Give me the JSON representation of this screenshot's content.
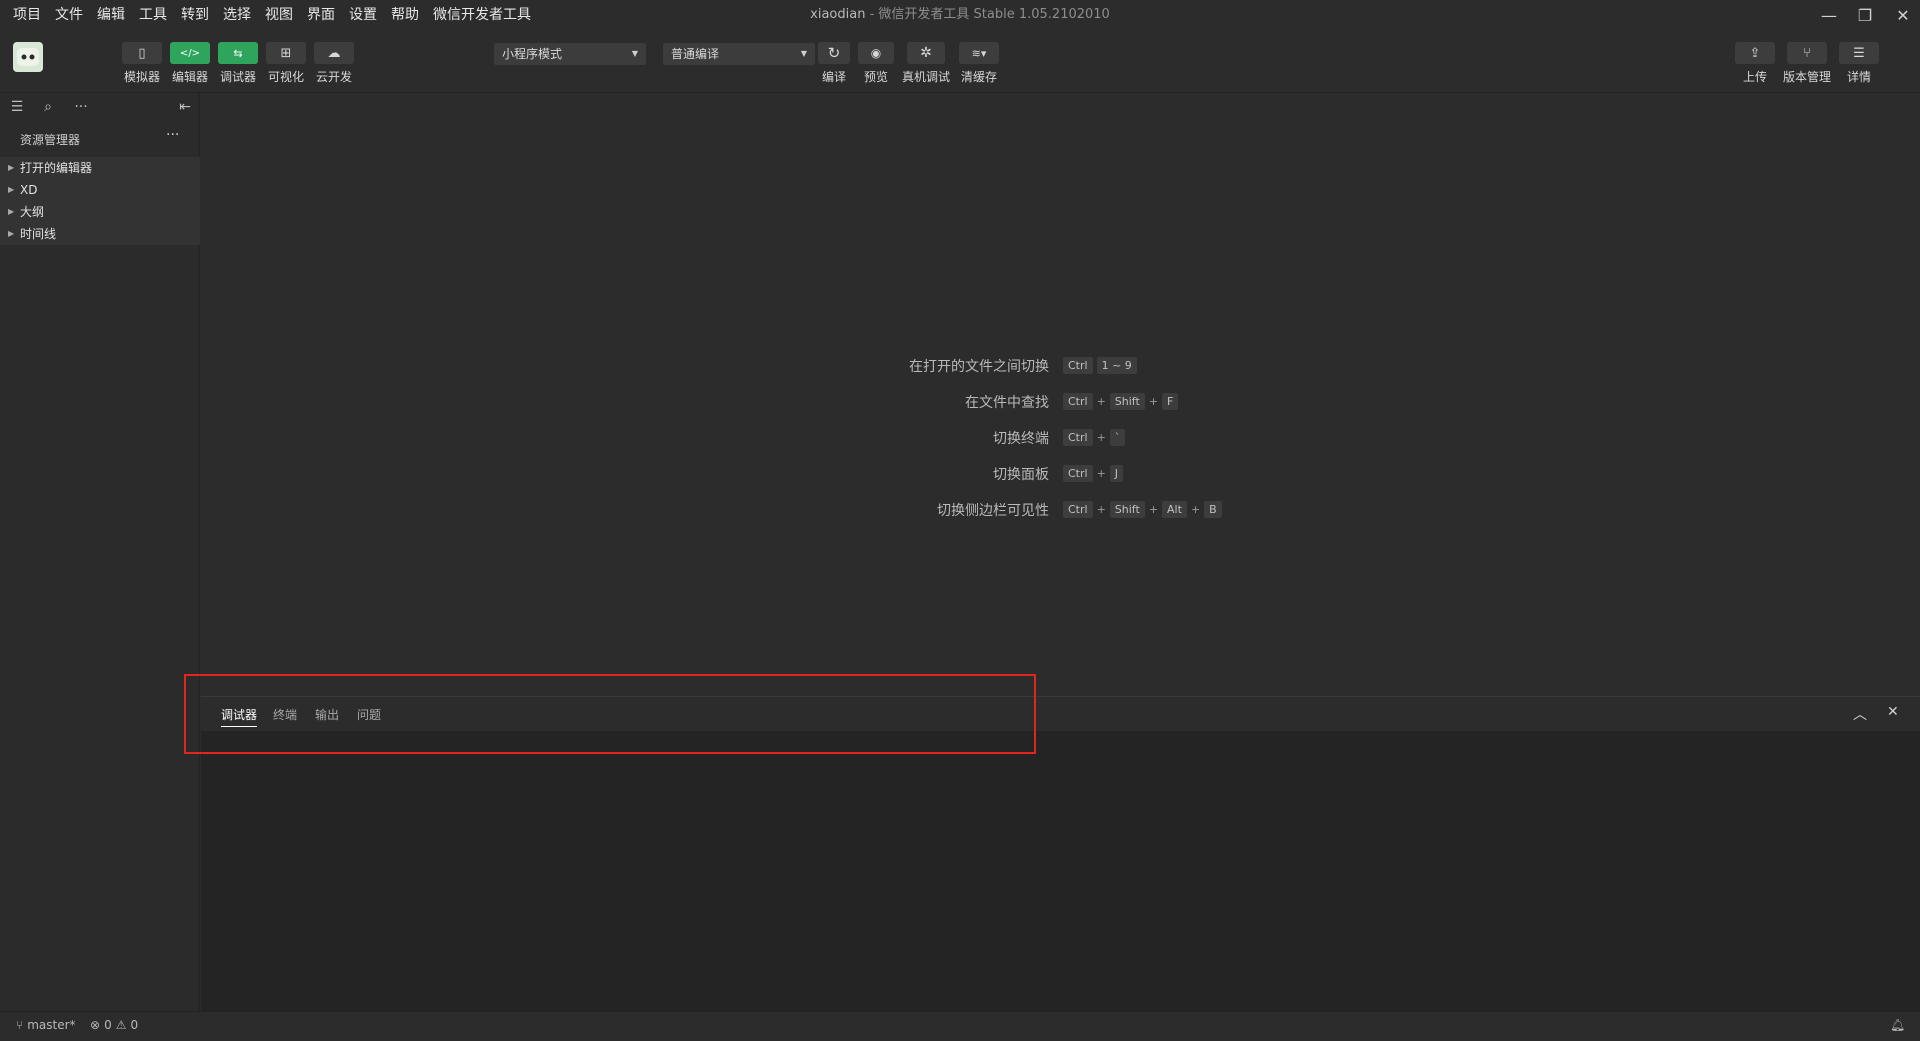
{
  "window": {
    "title_project": "xiaodian",
    "title_app": " - 微信开发者工具 Stable 1.05.2102010"
  },
  "menu": [
    "项目",
    "文件",
    "编辑",
    "工具",
    "转到",
    "选择",
    "视图",
    "界面",
    "设置",
    "帮助",
    "微信开发者工具"
  ],
  "toolbar": {
    "left_buttons": [
      {
        "label": "模拟器",
        "icon": "phone-icon",
        "glyph": "▯"
      },
      {
        "label": "编辑器",
        "icon": "code-icon",
        "glyph": "</>"
      },
      {
        "label": "调试器",
        "icon": "debug-icon",
        "glyph": "⇆"
      },
      {
        "label": "可视化",
        "icon": "layout-icon",
        "glyph": "⊞"
      },
      {
        "label": "云开发",
        "icon": "cloud-icon",
        "glyph": "☁"
      }
    ],
    "mode_select": "小程序模式",
    "compile_select": "普通编译",
    "mid_buttons": [
      {
        "label": "编译",
        "icon": "refresh-icon",
        "glyph": "↻"
      },
      {
        "label": "预览",
        "icon": "eye-icon",
        "glyph": "◉"
      },
      {
        "label": "真机调试",
        "icon": "bug-icon",
        "glyph": "✲"
      },
      {
        "label": "清缓存",
        "icon": "layers-icon",
        "glyph": "≋▾"
      }
    ],
    "right_buttons": [
      {
        "label": "上传",
        "icon": "upload-icon",
        "glyph": "⇪"
      },
      {
        "label": "版本管理",
        "icon": "branch-icon",
        "glyph": "⑂"
      },
      {
        "label": "详情",
        "icon": "menu-icon",
        "glyph": "☰"
      }
    ]
  },
  "sidebar": {
    "explorer_title": "资源管理器",
    "more": "···",
    "items": [
      "打开的编辑器",
      "XD",
      "大纲",
      "时间线"
    ]
  },
  "shortcuts": [
    {
      "label": "在打开的文件之间切换",
      "keys": [
        "Ctrl",
        "1 ~ 9"
      ]
    },
    {
      "label": "在文件中查找",
      "keys": [
        "Ctrl",
        "+",
        "Shift",
        "+",
        "F"
      ]
    },
    {
      "label": "切换终端",
      "keys": [
        "Ctrl",
        "+",
        "`"
      ]
    },
    {
      "label": "切换面板",
      "keys": [
        "Ctrl",
        "+",
        "J"
      ]
    },
    {
      "label": "切换侧边栏可见性",
      "keys": [
        "Ctrl",
        "+",
        "Shift",
        "+",
        "Alt",
        "+",
        "B"
      ]
    }
  ],
  "panel": {
    "tabs": [
      "调试器",
      "终端",
      "输出",
      "问题"
    ],
    "active_tab": 0
  },
  "status": {
    "branch": "master*",
    "errors": "0",
    "warnings": "0"
  },
  "colors": {
    "accent_green": "#2ea45c",
    "highlight_red": "#e0261e"
  }
}
